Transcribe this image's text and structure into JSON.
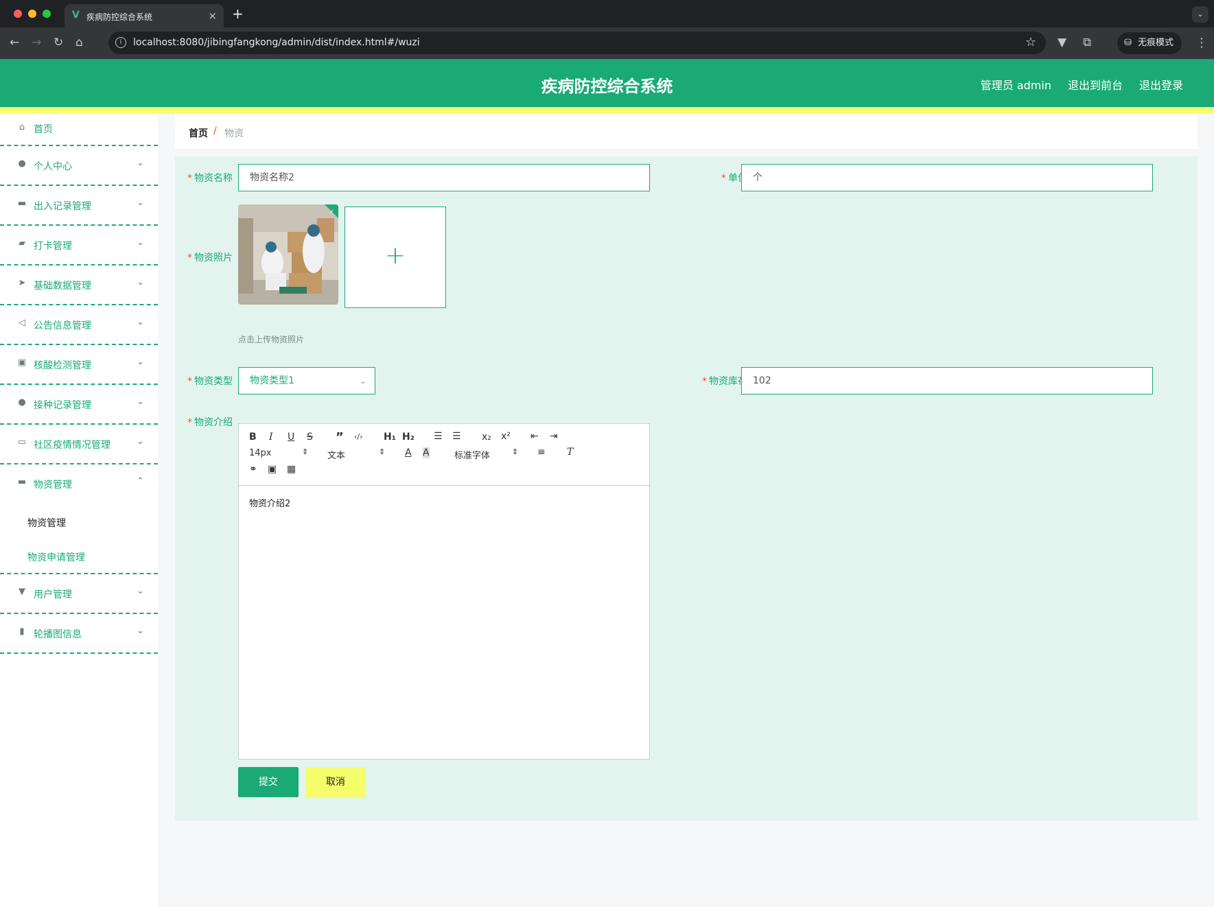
{
  "browser": {
    "tab_title": "疾病防控综合系统",
    "url": "localhost:8080/jibingfangkong/admin/dist/index.html#/wuzi",
    "incognito_label": "无痕模式"
  },
  "header": {
    "title": "疾病防控综合系统",
    "admin_label": "管理员 admin",
    "to_front": "退出到前台",
    "logout": "退出登录"
  },
  "sidebar": {
    "items": [
      {
        "label": "首页",
        "icon": "home-icon"
      },
      {
        "label": "个人中心",
        "icon": "user-icon"
      },
      {
        "label": "出入记录管理",
        "icon": "truck-icon"
      },
      {
        "label": "打卡管理",
        "icon": "wallet-icon"
      },
      {
        "label": "基础数据管理",
        "icon": "send-icon"
      },
      {
        "label": "公告信息管理",
        "icon": "location-icon"
      },
      {
        "label": "核酸检测管理",
        "icon": "briefcase-icon"
      },
      {
        "label": "接种记录管理",
        "icon": "user-icon"
      },
      {
        "label": "社区疫情情况管理",
        "icon": "chat-icon"
      },
      {
        "label": "物资管理",
        "icon": "message-icon"
      },
      {
        "label": "用户管理",
        "icon": "stamp-icon"
      },
      {
        "label": "轮播图信息",
        "icon": "bar-chart-icon"
      }
    ],
    "sub_items": [
      "物资管理",
      "物资申请管理"
    ]
  },
  "breadcrumb": {
    "home": "首页",
    "separator": "/",
    "current": "物资"
  },
  "form": {
    "name_label": "物资名称",
    "name_value": "物资名称2",
    "unit_label": "单位",
    "unit_value": "个",
    "photo_label": "物资照片",
    "photo_hint": "点击上传物资照片",
    "type_label": "物资类型",
    "type_value": "物资类型1",
    "stock_label": "物资库存",
    "stock_value": "102",
    "intro_label": "物资介绍",
    "intro_value": "物资介绍2",
    "required_mark": "*",
    "submit": "提交",
    "cancel": "取消"
  },
  "editor": {
    "font_size": "14px",
    "block_format": "文本",
    "font_family": "标准字体"
  },
  "colors": {
    "primary": "#1aaa76",
    "accent_yellow": "#f5fd6b",
    "panel_bg": "#e3f4ee",
    "required": "#f0503a"
  }
}
